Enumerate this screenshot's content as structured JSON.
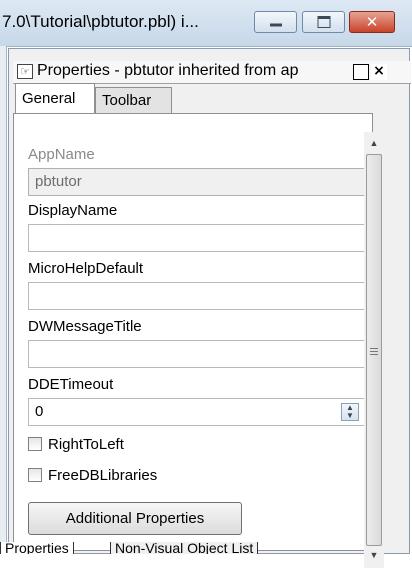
{
  "window": {
    "title": "7.0\\Tutorial\\pbtutor.pbl) i...",
    "minimize_icon": "minimize-icon",
    "maximize_icon": "maximize-icon",
    "close_icon": "close-icon"
  },
  "panel": {
    "title": "Properties - pbtutor inherited from ap",
    "restore_glyph": "□",
    "close_glyph": "×"
  },
  "tabs": [
    {
      "label": "General",
      "active": true
    },
    {
      "label": "Toolbar",
      "active": false
    }
  ],
  "form": {
    "appname_label": "AppName",
    "appname_value": "pbtutor",
    "displayname_label": "DisplayName",
    "displayname_value": "",
    "microhelp_label": "MicroHelpDefault",
    "microhelp_value": "",
    "dwmessage_label": "DWMessageTitle",
    "dwmessage_value": "",
    "ddetimeout_label": "DDETimeout",
    "ddetimeout_value": "0",
    "righttoleft_label": "RightToLeft",
    "freedb_label": "FreeDBLibraries",
    "additional_button": "Additional Properties"
  },
  "bottom_tabs": [
    {
      "label": "Properties"
    },
    {
      "label": "Non-Visual Object List"
    }
  ]
}
